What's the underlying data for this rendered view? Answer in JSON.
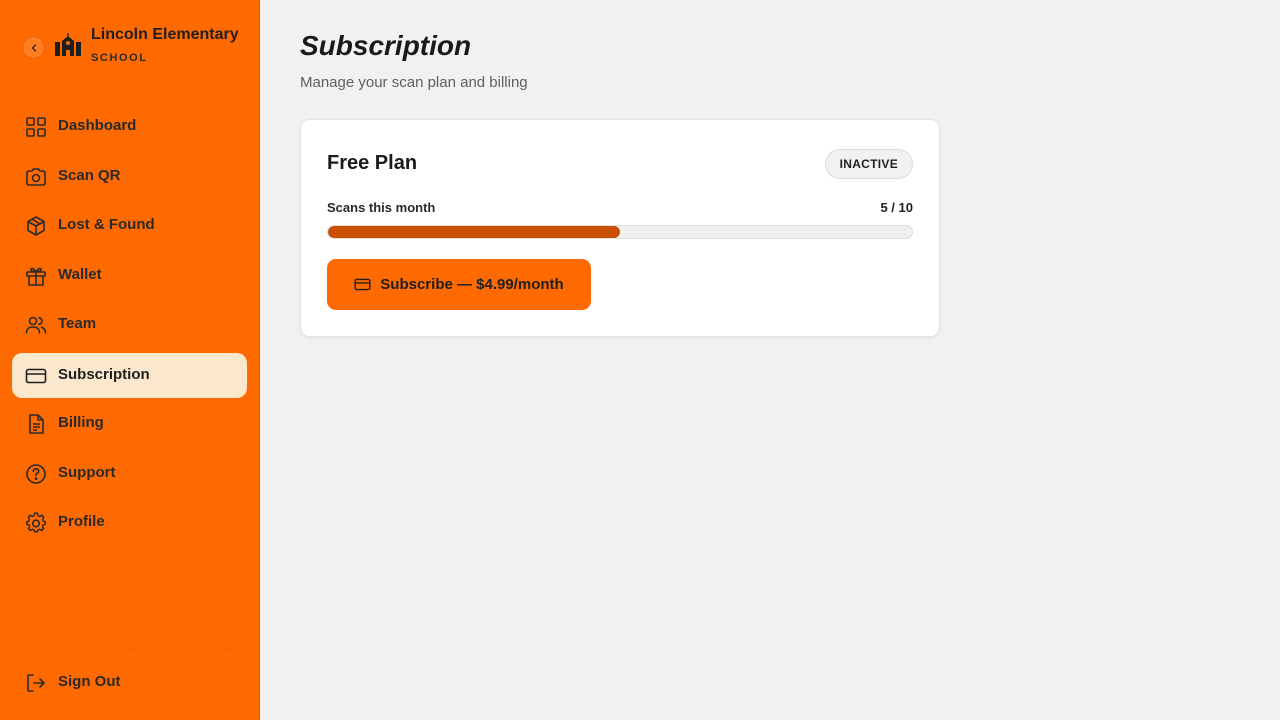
{
  "brand": {
    "name": "Lincoln Elementary",
    "subtitle": "SCHOOL",
    "icons": {
      "collapse": "chevron-left-icon",
      "logo": "school-building-icon"
    }
  },
  "nav": {
    "items": [
      {
        "id": "dashboard",
        "label": "Dashboard",
        "icon": "grid-icon",
        "active": false
      },
      {
        "id": "scan-qr",
        "label": "Scan QR",
        "icon": "camera-icon",
        "active": false
      },
      {
        "id": "lost-found",
        "label": "Lost & Found",
        "icon": "box-icon",
        "active": false
      },
      {
        "id": "wallet",
        "label": "Wallet",
        "icon": "gift-icon",
        "active": false
      },
      {
        "id": "team",
        "label": "Team",
        "icon": "users-icon",
        "active": false
      },
      {
        "id": "subscription",
        "label": "Subscription",
        "icon": "credit-card-icon",
        "active": true
      },
      {
        "id": "billing",
        "label": "Billing",
        "icon": "file-text-icon",
        "active": false
      },
      {
        "id": "support",
        "label": "Support",
        "icon": "help-circle-icon",
        "active": false
      },
      {
        "id": "profile",
        "label": "Profile",
        "icon": "gear-icon",
        "active": false
      }
    ],
    "sign_out": {
      "label": "Sign Out",
      "icon": "log-out-icon"
    }
  },
  "page": {
    "title": "Subscription",
    "subtitle": "Manage your scan plan and billing"
  },
  "plan": {
    "name": "Free Plan",
    "status": "INACTIVE",
    "usage_label": "Scans this month",
    "usage_count": "5 / 10",
    "usage_fraction": 0.5,
    "subscribe_label": "Subscribe — $4.99/month",
    "subscribe_icon": "credit-card-icon"
  },
  "colors": {
    "sidebar": "#ff6a00",
    "active_nav": "#fbe7cc",
    "accent": "#ff6a00",
    "progress": "#c85000",
    "background": "#f1f1f1"
  }
}
